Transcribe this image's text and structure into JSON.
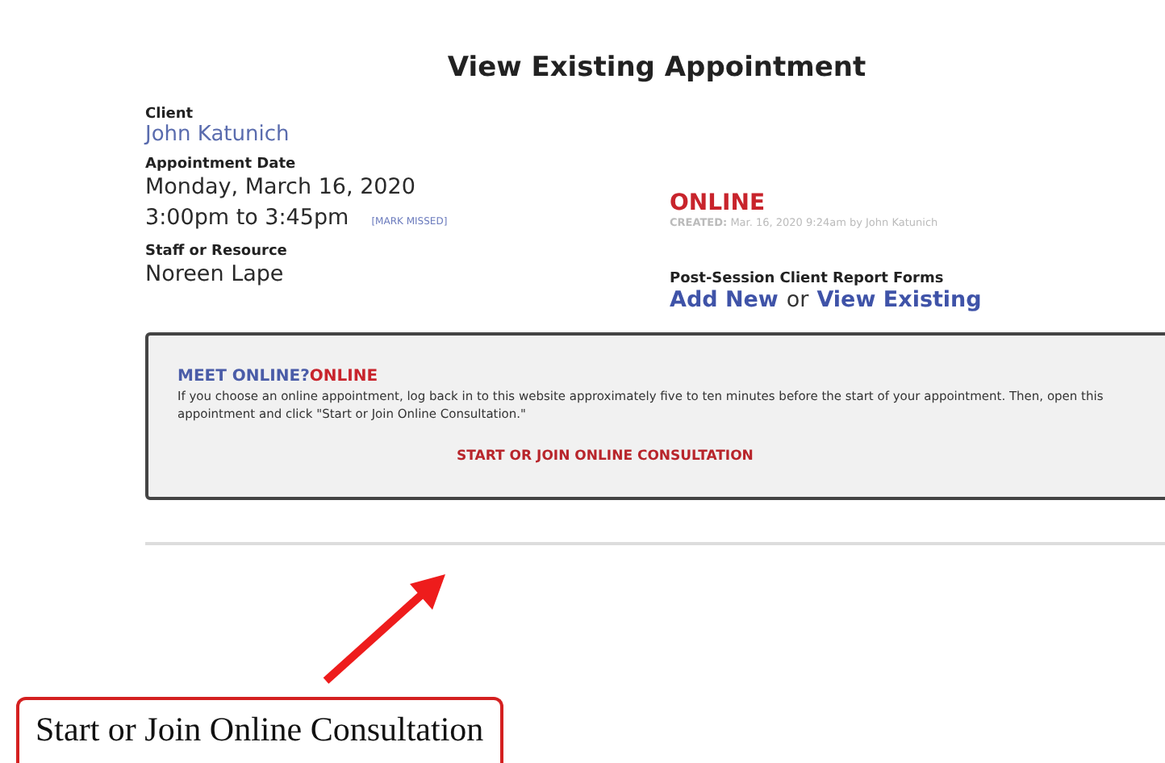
{
  "page_title": "View Existing Appointment",
  "client": {
    "label": "Client",
    "value": "John Katunich"
  },
  "appointment_date": {
    "label": "Appointment Date",
    "date": "Monday, March 16, 2020",
    "time": "3:00pm to 3:45pm",
    "action": "[MARK MISSED]"
  },
  "status": {
    "text": "ONLINE",
    "created_label": "CREATED:",
    "created_text": "Mar. 16, 2020 9:24am by John Katunich"
  },
  "staff": {
    "label": "Staff or Resource",
    "value": "Noreen Lape"
  },
  "report_forms": {
    "label": "Post-Session Client Report Forms",
    "add_link": "Add New",
    "separator": "or",
    "view_link": "View Existing"
  },
  "meet_online": {
    "label": "MEET ONLINE?",
    "value": "ONLINE",
    "description": "If you choose an online appointment, log back in to this website approximately five to ten minutes before the start of your appointment. Then, open this appointment and click \"Start or Join Online Consultation.\"",
    "link": "START OR JOIN ONLINE CONSULTATION"
  },
  "callout": {
    "text": "Start or Join Online Consultation"
  }
}
